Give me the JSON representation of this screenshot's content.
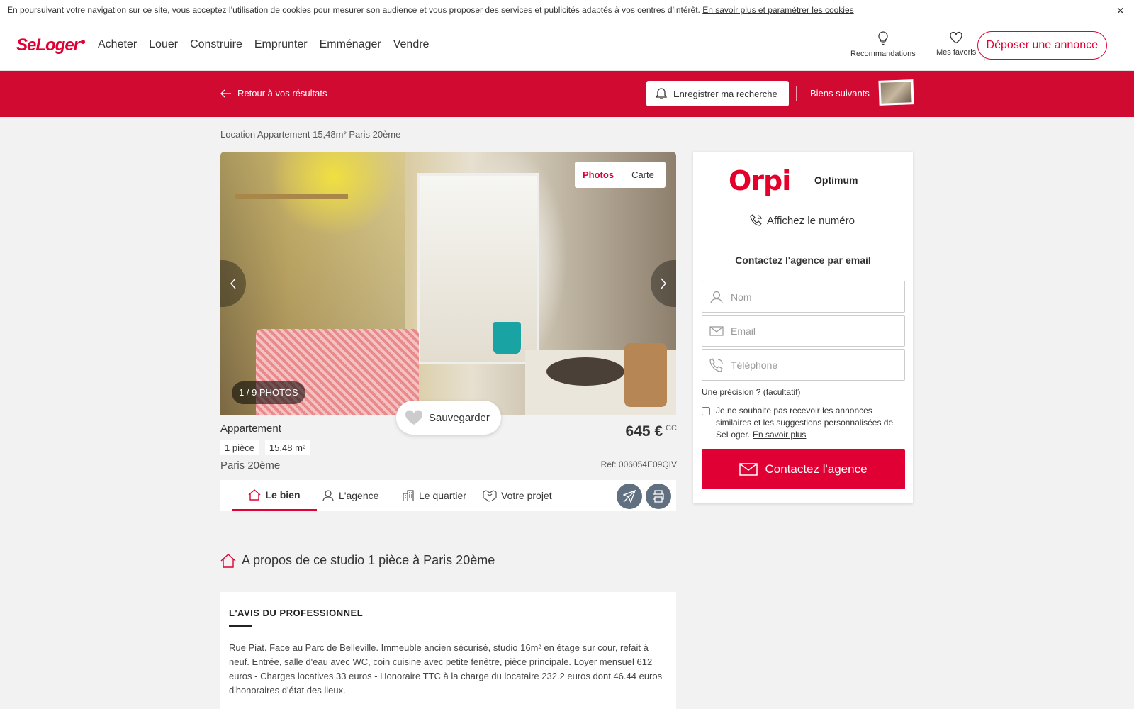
{
  "cookie": {
    "text": "En poursuivant votre navigation sur ce site, vous acceptez l’utilisation de cookies pour mesurer son audience et vous proposer des services et publicités adaptés à vos centres d’intérêt.",
    "link": "En savoir plus et paramétrer les cookies",
    "close": "×"
  },
  "header": {
    "logo": "SeLoger",
    "nav": [
      "Acheter",
      "Louer",
      "Construire",
      "Emprunter",
      "Emménager",
      "Vendre"
    ],
    "recommandations": "Recommandations",
    "favoris": "Mes favoris",
    "deposer": "Déposer une annonce"
  },
  "redbar": {
    "retour": "Retour à vos résultats",
    "enregistrer": "Enregistrer ma recherche",
    "suivants": "Biens suivants"
  },
  "breadcrumb": "Location Appartement 15,48m² Paris 20ème",
  "photo": {
    "tab_photos": "Photos",
    "tab_carte": "Carte",
    "counter": "1 / 9 PHOTOS"
  },
  "save_label": "Sauvegarder",
  "listing": {
    "type": "Appartement",
    "chips": [
      "1 pièce",
      "15,48 m²"
    ],
    "city": "Paris 20ème",
    "price": "645 €",
    "price_suffix": "CC",
    "ref": "Réf: 006054E09QIV"
  },
  "tabs": [
    "Le bien",
    "L'agence",
    "Le quartier",
    "Votre projet"
  ],
  "about_title": "A propos de ce studio 1 pièce à Paris 20ème",
  "avis": {
    "heading": "L'AVIS DU PROFESSIONNEL",
    "text": "Rue Piat. Face au Parc de Belleville. Immeuble ancien sécurisé, studio 16m² en étage sur cour, refait à neuf. Entrée, salle d'eau avec WC, coin cuisine avec petite fenêtre, pièce principale. Loyer mensuel 612 euros - Charges locatives 33 euros - Honoraire TTC à la charge du locataire 232.2 euros dont 46.44 euros d'honoraires d'état des lieux."
  },
  "agency": {
    "logo": "Orpi",
    "name": "Optimum",
    "phone_link": "Affichez le numéro",
    "contact_title": "Contactez l'agence par email",
    "placeholders": {
      "nom": "Nom",
      "email": "Email",
      "telephone": "Téléphone"
    },
    "precision": "Une précision ? (facultatif)",
    "optout": "Je ne souhaite pas recevoir les annonces similaires et les suggestions personnalisées de SeLoger.",
    "optout_link": "En savoir plus",
    "cta": "Contactez l'agence"
  },
  "colors": {
    "brand": "#e00034",
    "redbar": "#d10a32",
    "orpi": "#e4002b"
  }
}
